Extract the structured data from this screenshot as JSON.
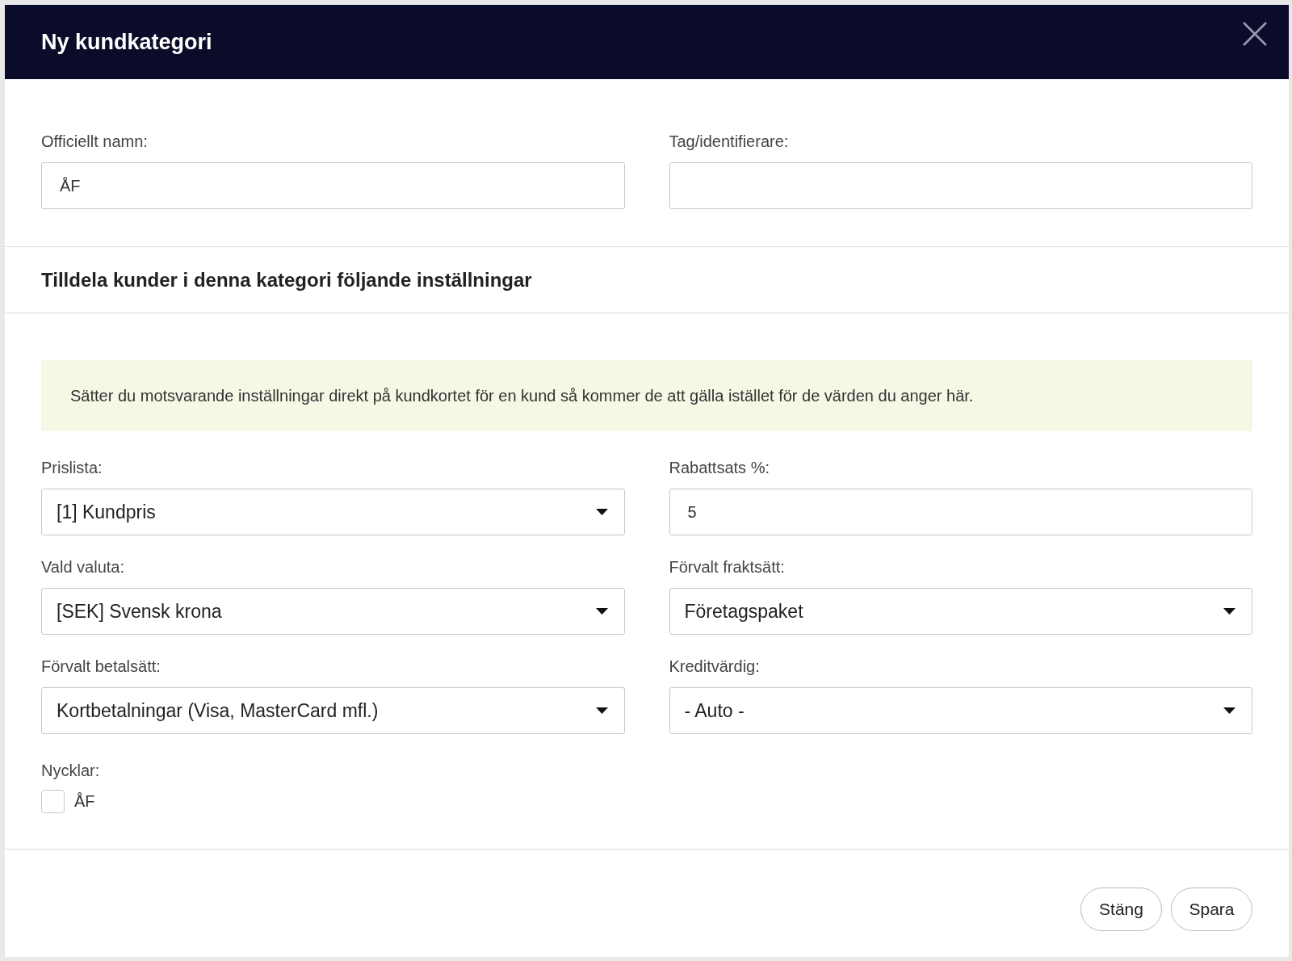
{
  "dialog": {
    "title": "Ny kundkategori"
  },
  "top_fields": [
    {
      "label": "Officiellt namn:",
      "kind": "input",
      "value": "ÅF"
    },
    {
      "label": "Tag/identifierare:",
      "kind": "input"
    }
  ],
  "section_heading": "Tilldela kunder i denna kategori följande inställningar",
  "notice": "Sätter du motsvarande inställningar direkt på kundkortet för en kund så kommer de att gälla istället för de värden du anger här.",
  "settings": [
    {
      "label": "Prislista:",
      "kind": "select",
      "value": "[1] Kundpris"
    },
    {
      "label": "Rabattsats %:",
      "kind": "input",
      "value": "5"
    },
    {
      "label": "Vald valuta:",
      "kind": "select",
      "value": "[SEK] Svensk krona"
    },
    {
      "label": "Förvalt fraktsätt:",
      "kind": "select",
      "value": "Företagspaket"
    },
    {
      "label": "Förvalt betalsätt:",
      "kind": "select",
      "value": "Kortbetalningar (Visa, MasterCard mfl.)"
    },
    {
      "label": "Kreditvärdig:",
      "kind": "select",
      "value": "- Auto -"
    }
  ],
  "keys": {
    "label": "Nycklar:",
    "items": [
      {
        "label": "ÅF",
        "checked": false
      }
    ]
  },
  "buttons": [
    {
      "label": "Stäng"
    },
    {
      "label": "Spara"
    }
  ]
}
